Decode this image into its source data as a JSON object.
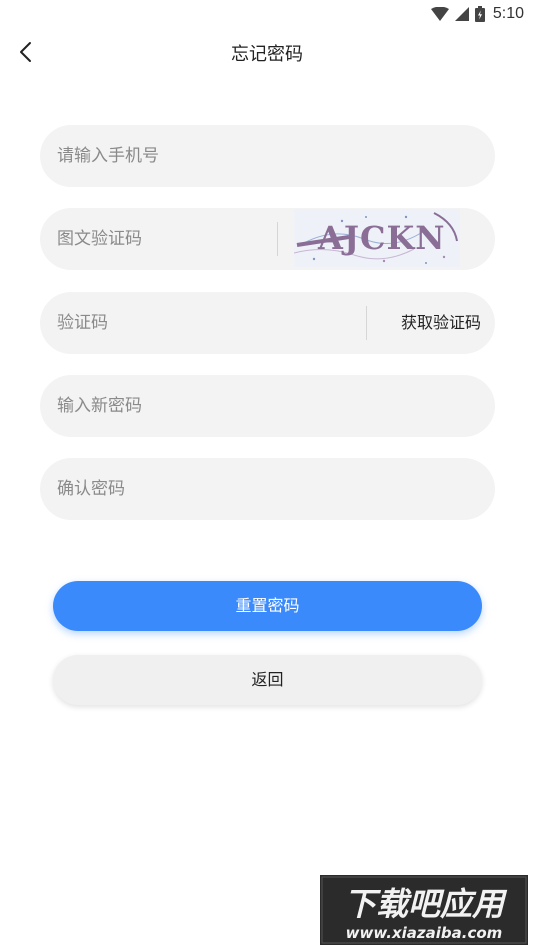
{
  "status_bar": {
    "time": "5:10",
    "icons": [
      "wifi-icon",
      "signal-icon",
      "battery-icon"
    ]
  },
  "header": {
    "title": "忘记密码",
    "back_icon": "back-arrow-icon"
  },
  "form": {
    "phone_placeholder": "请输入手机号",
    "captcha_placeholder": "图文验证码",
    "captcha_image_text": "AJCKN",
    "sms_code_placeholder": "验证码",
    "get_code_label": "获取验证码",
    "new_password_placeholder": "输入新密码",
    "confirm_password_placeholder": "确认密码"
  },
  "actions": {
    "reset_label": "重置密码",
    "back_label": "返回"
  },
  "watermark": {
    "title": "下载吧应用",
    "url": "www.xiazaiba.com"
  },
  "colors": {
    "primary": "#3a8afc",
    "field_background": "#f3f3f3",
    "secondary_button": "#f0f0f0",
    "captcha_text": "#8a6e96"
  }
}
